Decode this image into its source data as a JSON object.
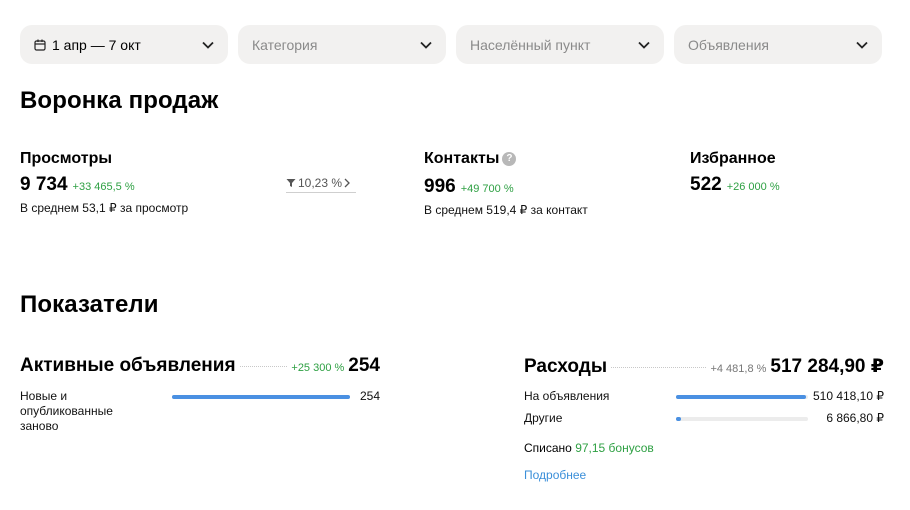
{
  "filters": {
    "period": "1 апр — 7 окт",
    "category": "Категория",
    "locality": "Населённый пункт",
    "ads": "Объявления"
  },
  "funnel": {
    "title": "Воронка продаж",
    "views": {
      "title": "Просмотры",
      "value": "9 734",
      "delta": "+33 465,5 %",
      "avg": "В среднем 53,1 ₽ за просмотр"
    },
    "conversion": "10,23 %",
    "contacts": {
      "title": "Контакты",
      "value": "996",
      "delta": "+49 700 %",
      "avg": "В среднем 519,4 ₽ за контакт"
    },
    "favorites": {
      "title": "Избранное",
      "value": "522",
      "delta": "+26 000 %"
    }
  },
  "indicators": {
    "title": "Показатели",
    "active": {
      "title": "Активные объявления",
      "delta": "+25 300 %",
      "value": "254",
      "rows": [
        {
          "label": "Новые и опубликованные заново",
          "value": "254",
          "fraction": 1.0
        }
      ]
    },
    "expenses": {
      "title": "Расходы",
      "delta": "+4 481,8 %",
      "value": "517 284,90 ₽",
      "rows": [
        {
          "label": "На объявления",
          "value": "510 418,10 ₽",
          "fraction": 0.987
        },
        {
          "label": "Другие",
          "value": "6 866,80 ₽",
          "fraction": 0.04
        }
      ],
      "written_prefix": "Списано",
      "written_bonus": "97,15 бонусов",
      "more_link": "Подробнее"
    }
  },
  "colors": {
    "accent": "#4a90e2",
    "positive": "#2ea043",
    "link": "#3b8fd9"
  }
}
